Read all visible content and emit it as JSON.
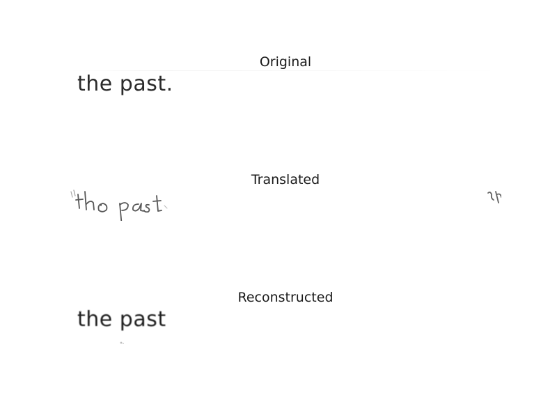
{
  "panels": {
    "original": {
      "title": "Original",
      "text": "the past."
    },
    "translated": {
      "title": "Translated",
      "handwriting_text": "tho past"
    },
    "reconstructed": {
      "title": "Reconstructed",
      "text": "the past"
    }
  },
  "colors": {
    "background": "#ffffff",
    "ink": "#2b2b2b",
    "title": "#1a1a1a"
  }
}
